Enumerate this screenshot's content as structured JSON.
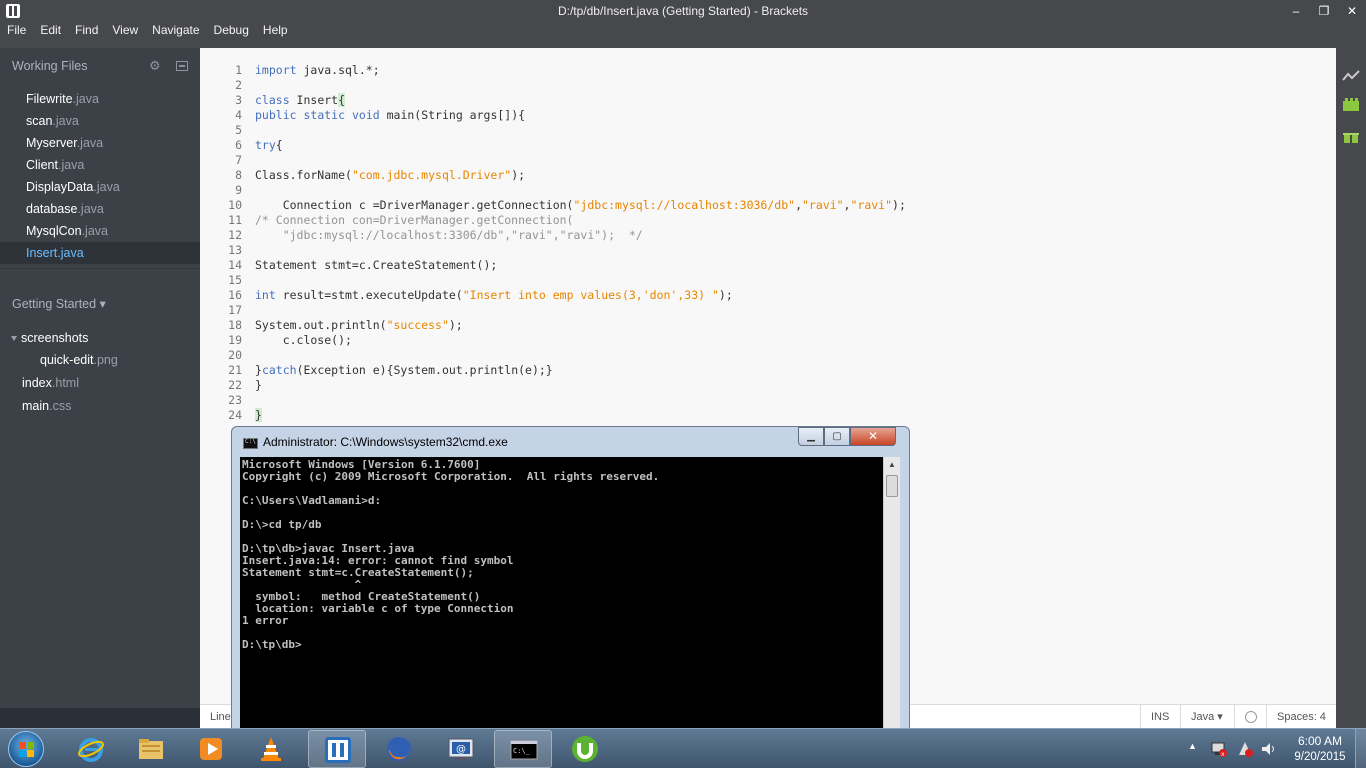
{
  "window": {
    "title": "D:/tp/db/Insert.java (Getting Started) - Brackets",
    "menu": [
      "File",
      "Edit",
      "Find",
      "View",
      "Navigate",
      "Debug",
      "Help"
    ],
    "controls": [
      "–",
      "❐",
      "✕"
    ]
  },
  "sidebar": {
    "working_files_title": "Working Files",
    "files": [
      {
        "name": "Filewrite",
        "ext": ".java"
      },
      {
        "name": "scan",
        "ext": ".java"
      },
      {
        "name": "Myserver",
        "ext": ".java"
      },
      {
        "name": "Client",
        "ext": ".java"
      },
      {
        "name": "DisplayData",
        "ext": ".java"
      },
      {
        "name": "database",
        "ext": ".java"
      },
      {
        "name": "MysqlCon",
        "ext": ".java"
      },
      {
        "name": "Insert",
        "ext": ".java",
        "selected": true
      }
    ],
    "project_title": "Getting Started ▾",
    "tree": [
      {
        "name": "screenshots",
        "ext": "",
        "folder": true
      },
      {
        "name": "quick-edit",
        "ext": ".png"
      },
      {
        "name": "index",
        "ext": ".html"
      },
      {
        "name": "main",
        "ext": ".css"
      }
    ]
  },
  "editor": {
    "line_numbers": [
      "1",
      "2",
      "3",
      "4",
      "5",
      "6",
      "7",
      "8",
      "9",
      "10",
      "11",
      "12",
      "13",
      "14",
      "15",
      "16",
      "17",
      "18",
      "19",
      "20",
      "21",
      "22",
      "23",
      "24"
    ],
    "lines": [
      "import java.sql.*;",
      "",
      "class Insert{",
      "public static void main(String args[]){",
      "",
      "try{",
      "",
      "Class.forName(\"com.jdbc.mysql.Driver\");",
      "",
      "    Connection c =DriverManager.getConnection(\"jdbc:mysql://localhost:3036/db\",\"ravi\",\"ravi\");",
      "/* Connection con=DriverManager.getConnection(",
      "    \"jdbc:mysql://localhost:3306/db\",\"ravi\",\"ravi\");  */",
      "",
      "Statement stmt=c.CreateStatement();",
      "",
      "int result=stmt.executeUpdate(\"Insert into emp values(3,'don',33) \");",
      "",
      "System.out.println(\"success\");",
      "    c.close();",
      "",
      "}catch(Exception e){System.out.println(e);}",
      "}",
      "",
      "}"
    ]
  },
  "statusbar": {
    "position": "Line",
    "ins": "INS",
    "language": "Java ▾",
    "spaces": "Spaces: 4"
  },
  "cmd": {
    "title": "Administrator: C:\\Windows\\system32\\cmd.exe",
    "lines": [
      "Microsoft Windows [Version 6.1.7600]",
      "Copyright (c) 2009 Microsoft Corporation.  All rights reserved.",
      "",
      "C:\\Users\\Vadlamani>d:",
      "",
      "D:\\>cd tp/db",
      "",
      "D:\\tp\\db>javac Insert.java",
      "Insert.java:14: error: cannot find symbol",
      "Statement stmt=c.CreateStatement();",
      "                 ^",
      "  symbol:   method CreateStatement()",
      "  location: variable c of type Connection",
      "1 error",
      "",
      "D:\\tp\\db>"
    ]
  },
  "taskbar": {
    "time": "6:00 AM",
    "date": "9/20/2015",
    "icons": [
      "ie-icon",
      "explorer-icon",
      "media-player-icon",
      "vlc-icon",
      "brackets-icon",
      "firefox-icon",
      "outlook-icon",
      "cmd-icon",
      "utorrent-icon"
    ]
  },
  "colors": {
    "keyword": "#446fbd",
    "string": "#e88501",
    "comment": "#949494",
    "sidebar_bg": "#3c4148",
    "selected_file": "#6bbeff"
  }
}
